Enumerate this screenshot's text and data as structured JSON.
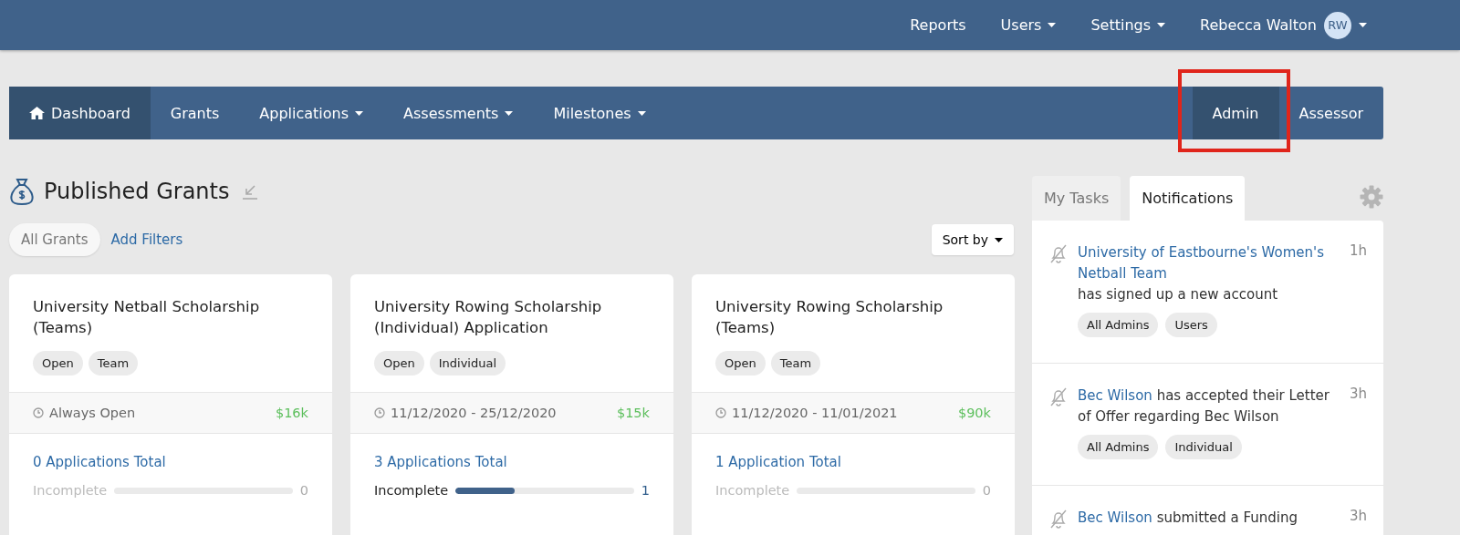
{
  "top_bar": {
    "items": [
      {
        "label": "Reports",
        "dropdown": false
      },
      {
        "label": "Users",
        "dropdown": true
      },
      {
        "label": "Settings",
        "dropdown": true
      }
    ],
    "user": {
      "name": "Rebecca Walton",
      "initials": "RW"
    }
  },
  "nav": {
    "items": [
      {
        "label": "Dashboard",
        "selected": true,
        "dropdown": false
      },
      {
        "label": "Grants",
        "selected": false,
        "dropdown": false
      },
      {
        "label": "Applications",
        "selected": false,
        "dropdown": true
      },
      {
        "label": "Assessments",
        "selected": false,
        "dropdown": true
      },
      {
        "label": "Milestones",
        "selected": false,
        "dropdown": true
      }
    ],
    "roles": [
      {
        "label": "Admin",
        "selected": true,
        "highlighted": true
      },
      {
        "label": "Assessor",
        "selected": false,
        "highlighted": false
      }
    ]
  },
  "page": {
    "title": "Published Grants",
    "filters": [
      {
        "label": "All Grants",
        "kind": "pill"
      },
      {
        "label": "Add Filters",
        "kind": "link"
      }
    ],
    "sort": "Sort by"
  },
  "grants": [
    {
      "title": "University Netball Scholarship (Teams)",
      "tags": [
        "Open",
        "Team"
      ],
      "dates": "Always Open",
      "amount": "$16k",
      "total": "0 Applications Total",
      "progress": {
        "label": "Incomplete",
        "level": 0,
        "count": "0"
      }
    },
    {
      "title": "University Rowing Scholarship (Individual) Application",
      "tags": [
        "Open",
        "Individual"
      ],
      "dates": "11/12/2020 - 25/12/2020",
      "amount": "$15k",
      "total": "3 Applications Total",
      "progress": {
        "label": "Incomplete",
        "level": 0.33,
        "count": "1"
      }
    },
    {
      "title": "University Rowing Scholarship (Teams)",
      "tags": [
        "Open",
        "Team"
      ],
      "dates": "11/12/2020 - 11/01/2021",
      "amount": "$90k",
      "total": "1 Application Total",
      "progress": {
        "label": "Incomplete",
        "level": 0,
        "count": "0"
      }
    }
  ],
  "side_panel": {
    "tabs": [
      {
        "label": "My Tasks",
        "selected": false
      },
      {
        "label": "Notifications",
        "selected": true
      }
    ],
    "notifications": [
      {
        "link": "University of Eastbourne's Women's Netball Team",
        "text": " has signed up a new account",
        "break": true,
        "time": "1h",
        "tags": [
          "All Admins",
          "Users"
        ]
      },
      {
        "link": "Bec Wilson",
        "text": " has accepted their Letter of Offer regarding Bec Wilson",
        "break": false,
        "time": "3h",
        "tags": [
          "All Admins",
          "Individual"
        ]
      },
      {
        "link": "Bec Wilson",
        "text": " submitted a Funding",
        "break": false,
        "time": "3h"
      }
    ]
  }
}
